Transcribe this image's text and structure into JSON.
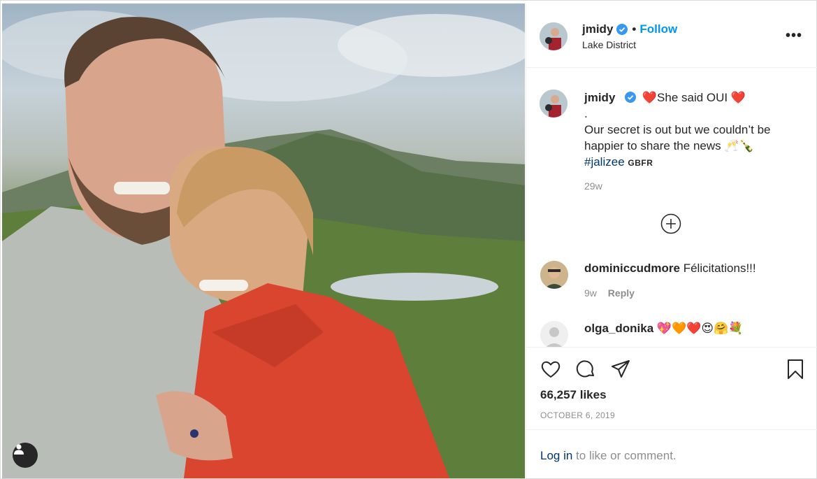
{
  "post": {
    "username": "jmidy",
    "follow_label": "Follow",
    "dot": "•",
    "location": "Lake District",
    "more_label": "•••"
  },
  "caption": {
    "username": "jmidy",
    "line1": "❤️She said OUI ❤️",
    "line2": ".",
    "line3": "Our secret is out but we couldn’t be happier to share the news 🥂🍾",
    "hashtag": "#jalizee",
    "suffix": "GBFR",
    "time": "29w"
  },
  "comments": [
    {
      "username": "dominiccudmore",
      "text": "Félicitations!!!",
      "time": "9w",
      "reply_label": "Reply"
    },
    {
      "username": "olga_donika",
      "text": "💖🧡❤️😍🤗💐"
    }
  ],
  "actions": {
    "likes": "66,257 likes",
    "date": "OCTOBER 6, 2019"
  },
  "login": {
    "link": "Log in",
    "rest": " to like or comment."
  },
  "colors": {
    "accent": "#0095f6",
    "link": "#00376b",
    "muted": "#8e8e8e",
    "text": "#262626",
    "sweater": "#d9452f"
  },
  "icons": [
    "verified-badge-icon",
    "more-options-icon",
    "add-circle-icon",
    "heart-icon",
    "comment-icon",
    "share-icon",
    "bookmark-icon",
    "user-tag-icon"
  ]
}
